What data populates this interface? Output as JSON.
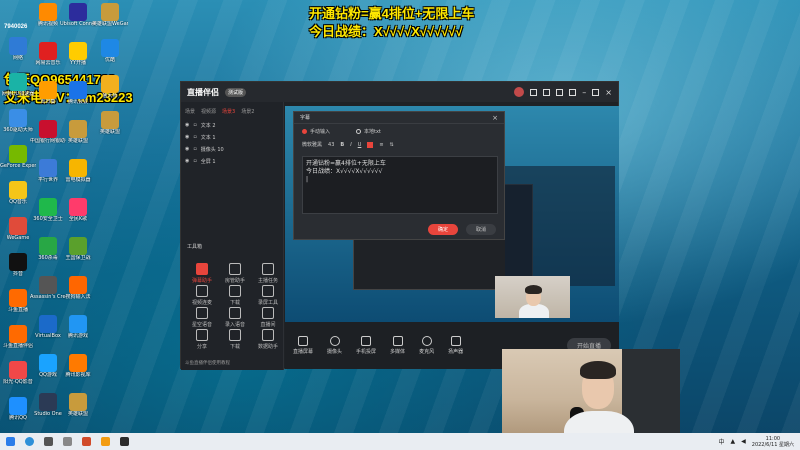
{
  "overlay": {
    "headline": "开通钻粉=赢4排位+无限上车",
    "record": "今日战绩：X√√√√X√√√√√√",
    "qq": "包天QQ965441769",
    "wechat": "艾米电竞V：am23223",
    "id_number": "7940026"
  },
  "desktop_icons_left": [
    {
      "label": "网络",
      "color": "#2f7bd6"
    },
    {
      "label": "网易UU加速器",
      "color": "#1ab3a6"
    },
    {
      "label": "360驱动大师",
      "color": "#3a8ee6"
    },
    {
      "label": "GeForce Experience",
      "color": "#76b900"
    },
    {
      "label": "QQ音乐",
      "color": "#f5c518"
    },
    {
      "label": "WeGame",
      "color": "#e04b3a"
    },
    {
      "label": "抖音",
      "color": "#111111"
    },
    {
      "label": "斗鱼直播",
      "color": "#ff6a00"
    },
    {
      "label": "斗鱼直播伴侣",
      "color": "#ff6a00"
    },
    {
      "label": "阳光·QQ影音",
      "color": "#f04848"
    },
    {
      "label": "腾讯QQ",
      "color": "#1e90ff"
    }
  ],
  "desktop_icons_col2": [
    {
      "label": "腾讯视频",
      "color": "#ff8a00"
    },
    {
      "label": "网易云音乐",
      "color": "#e02020"
    },
    {
      "label": "向日葵",
      "color": "#ff9d00"
    },
    {
      "label": "中国银行网银助手",
      "color": "#c8102e"
    },
    {
      "label": "平行世界",
      "color": "#3c7bd8"
    },
    {
      "label": "360安全卫士",
      "color": "#1fb84b"
    },
    {
      "label": "360杀毒",
      "color": "#28a745"
    },
    {
      "label": "Assassin's Creed",
      "color": "#555555"
    },
    {
      "label": "VirtualBox",
      "color": "#1b6ac9"
    },
    {
      "label": "QQ游戏",
      "color": "#1aa3ff"
    },
    {
      "label": "Studio One",
      "color": "#2b3a55"
    }
  ],
  "desktop_icons_col3": [
    {
      "label": "Ubisoft Connect",
      "color": "#2c2c9c"
    },
    {
      "label": "YY开播",
      "color": "#ffcc00"
    },
    {
      "label": "腾讯会议",
      "color": "#1a73e8"
    },
    {
      "label": "英雄联盟",
      "color": "#c89b3c"
    },
    {
      "label": "雷电模拟器",
      "color": "#f7b500"
    },
    {
      "label": "全民K歌",
      "color": "#ff3b6b"
    },
    {
      "label": "王国保卫战",
      "color": "#5aa02c"
    },
    {
      "label": "搜狗输入法",
      "color": "#ff6600"
    },
    {
      "label": "腾讯游戏",
      "color": "#2196f3"
    },
    {
      "label": "腾讯影视库",
      "color": "#ff7a00"
    },
    {
      "label": "英雄联盟",
      "color": "#c89b3c"
    }
  ],
  "desktop_icons_col4": [
    {
      "label": "英雄联盟WeGame版",
      "color": "#c89b3c"
    },
    {
      "label": "优酷",
      "color": "#1e88e5"
    },
    {
      "label": "鲁大师",
      "color": "#f2b01e"
    },
    {
      "label": "英雄联盟",
      "color": "#c89b3c"
    }
  ],
  "app": {
    "name": "直播伴侣",
    "version_badge": "测试版",
    "scene_tabs": [
      "场景",
      "视频源",
      "场景3",
      "场景2"
    ],
    "sources": [
      "文本 2",
      "文本 1",
      "摄像头 10",
      "全屏 1"
    ],
    "tools_title": "工具箱",
    "tools": [
      "弹幕助手",
      "房管助手",
      "主播任务",
      "视频连麦",
      "下载",
      "录屏工具",
      "星空语音",
      "录入语音",
      "直播间",
      "分享",
      "下载",
      "数据助手"
    ],
    "bottom_buttons": [
      "直播屏幕",
      "摄像头",
      "手机投屏",
      "多媒体",
      "麦克风",
      "扬声器"
    ],
    "live_button": "开始直播",
    "status": "斗鱼直播伴侣使用教程"
  },
  "dialog": {
    "title": "字幕",
    "radio_manual": "手动输入",
    "radio_file": "本地txt",
    "font": "微软雅黑",
    "size": "43",
    "bold": "B",
    "italic": "I",
    "underline": "U",
    "text_line1": "开通钻粉=赢4排位+无限上车",
    "text_line2": "今日战绩：X√√√√X√√√√√√",
    "ok": "确定",
    "cancel": "取消"
  },
  "taskbar": {
    "time": "11:00",
    "date": "2022/6/11 星期六",
    "ime": "中"
  }
}
